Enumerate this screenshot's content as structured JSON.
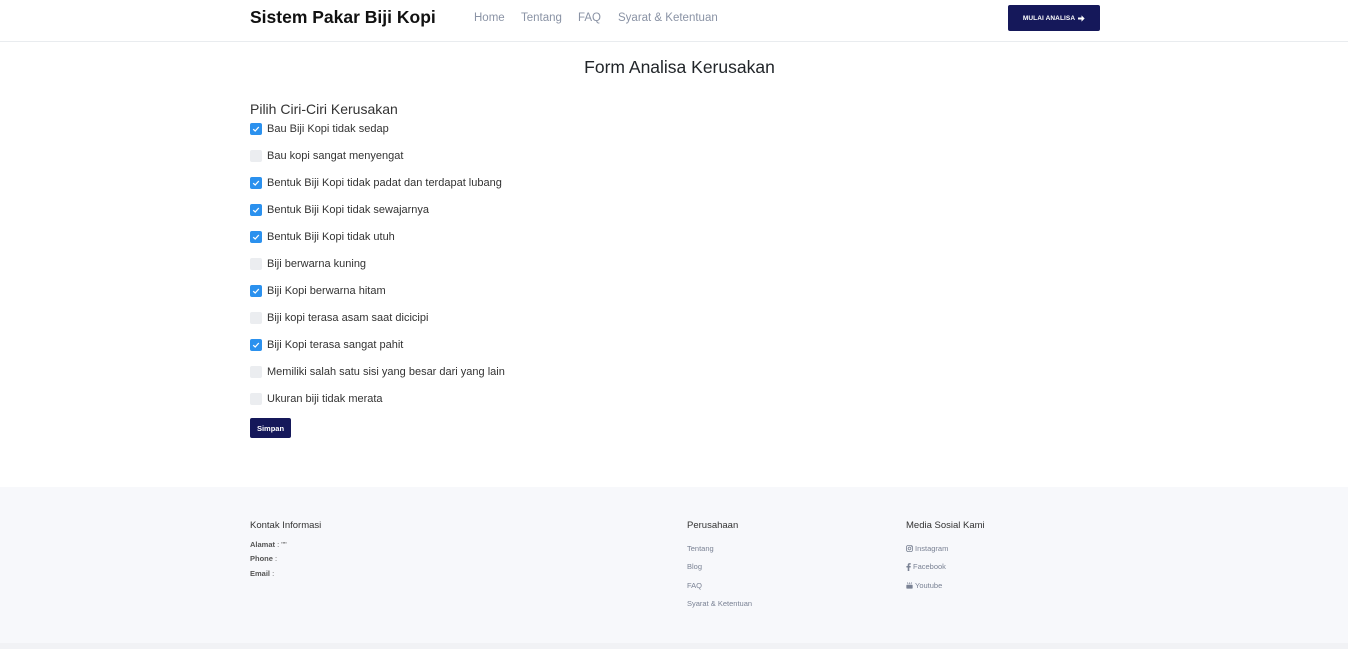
{
  "navbar": {
    "brand": "Sistem Pakar Biji Kopi",
    "links": [
      "Home",
      "Tentang",
      "FAQ",
      "Syarat & Ketentuan"
    ],
    "cta_label": "MULAI ANALISA",
    "cta_icon": "arrow-right-icon"
  },
  "main": {
    "title": "Form Analisa Kerusakan",
    "section_label": "Pilih Ciri-Ciri Kerusakan",
    "options": [
      {
        "label": "Bau Biji Kopi tidak sedap",
        "checked": true
      },
      {
        "label": "Bau kopi sangat menyengat",
        "checked": false
      },
      {
        "label": "Bentuk Biji Kopi tidak padat dan terdapat lubang",
        "checked": true
      },
      {
        "label": "Bentuk Biji Kopi tidak sewajarnya",
        "checked": true
      },
      {
        "label": "Bentuk Biji Kopi tidak utuh",
        "checked": true
      },
      {
        "label": "Biji berwarna kuning",
        "checked": false
      },
      {
        "label": "Biji Kopi berwarna hitam",
        "checked": true
      },
      {
        "label": "Biji kopi terasa asam saat dicicipi",
        "checked": false
      },
      {
        "label": "Biji Kopi terasa sangat pahit",
        "checked": true
      },
      {
        "label": "Memiliki salah satu sisi yang besar dari yang lain",
        "checked": false
      },
      {
        "label": "Ukuran biji tidak merata",
        "checked": false
      }
    ],
    "submit_label": "Simpan"
  },
  "footer": {
    "contact": {
      "heading": "Kontak Informasi",
      "address_label": "Alamat",
      "address_value": ": \"\"",
      "phone_label": "Phone",
      "phone_value": " :",
      "email_label": "Email",
      "email_value": " :"
    },
    "company": {
      "heading": "Perusahaan",
      "links": [
        "Tentang",
        "Blog",
        "FAQ",
        "Syarat & Ketentuan"
      ]
    },
    "social": {
      "heading": "Media Sosial Kami",
      "links": [
        {
          "label": "Instagram",
          "icon": "instagram-icon"
        },
        {
          "label": "Facebook",
          "icon": "facebook-icon"
        },
        {
          "label": "Youtube",
          "icon": "youtube-icon"
        }
      ]
    }
  },
  "colors": {
    "primary": "#15185a",
    "checkbox_checked": "#2b91ee",
    "checkbox_unchecked": "#ebedf0",
    "footer_bg": "#f7f8fb"
  }
}
